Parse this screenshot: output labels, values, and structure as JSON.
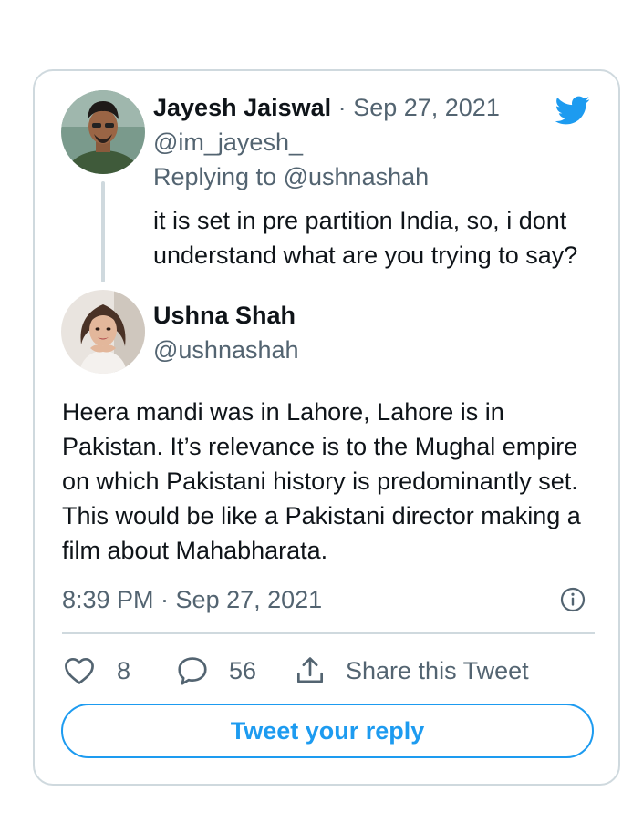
{
  "original_tweet": {
    "author_name": "Jayesh Jaiswal",
    "separator": "·",
    "date": "Sep 27, 2021",
    "handle": "@im_jayesh_",
    "replying_prefix": "Replying to",
    "replying_handle": "@ushnashah",
    "text": "it is set in pre partition India, so, i dont understand what are you trying to say?",
    "avatar_icon": "person-avatar"
  },
  "main_tweet": {
    "author_name": "Ushna Shah",
    "handle": "@ushnashah",
    "text": "Heera mandi was in Lahore, Lahore is in Pakistan. It’s relevance is to the Mughal empire on which Pakistani history is predominantly set. This would be like a Pakistani director making a film about Mahabharata.",
    "timestamp": "8:39 PM · Sep 27, 2021",
    "avatar_icon": "person-avatar"
  },
  "actions": {
    "like_count": "8",
    "reply_count": "56",
    "share_label": "Share this Tweet"
  },
  "reply_button_label": "Tweet your reply",
  "icons": {
    "brand": "twitter-bird-icon",
    "info": "info-icon",
    "like": "heart-icon",
    "reply": "speech-bubble-icon",
    "share": "share-upload-icon"
  },
  "colors": {
    "accent": "#1d9bf0",
    "text_primary": "#0f1419",
    "text_secondary": "#536471",
    "border": "#cfd9de"
  }
}
